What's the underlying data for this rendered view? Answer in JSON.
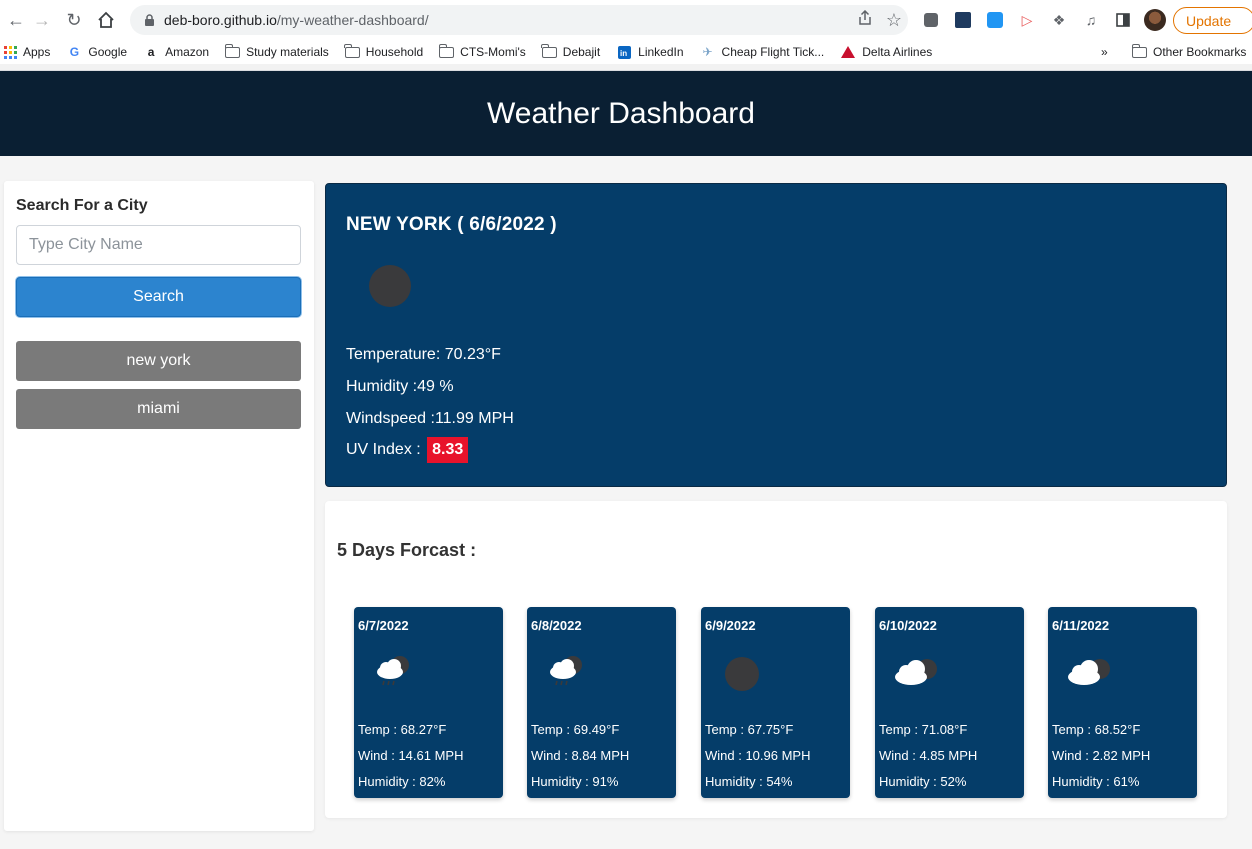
{
  "browser": {
    "url_host": "deb-boro.github.io",
    "url_path": "/my-weather-dashboard/",
    "update_label": "Update",
    "bookmarks": [
      "Apps",
      "Google",
      "Amazon",
      "Study materials",
      "Household",
      "CTS-Momi's",
      "Debajit",
      "LinkedIn",
      "Cheap Flight Tick...",
      "Delta Airlines"
    ],
    "overflow": "»",
    "other_bookmarks": "Other Bookmarks"
  },
  "header": {
    "title": "Weather Dashboard"
  },
  "sidebar": {
    "heading": "Search For a City",
    "input_placeholder": "Type City Name",
    "search_label": "Search",
    "history": [
      "new york",
      "miami"
    ]
  },
  "current": {
    "city_line": "NEW YORK ( 6/6/2022 )",
    "temperature": "Temperature: 70.23°F",
    "humidity": "Humidity :49 %",
    "windspeed": "Windspeed :11.99 MPH",
    "uv_label": "UV Index :",
    "uv_value": "8.33",
    "uv_color": "#e8132b",
    "icon": "dark-circle"
  },
  "forecast": {
    "heading": "5 Days Forcast :",
    "days": [
      {
        "date": "6/7/2022",
        "icon": "rain-cloud",
        "temp": "Temp : 68.27°F",
        "wind": "Wind : 14.61 MPH",
        "humidity": "Humidity : 82%"
      },
      {
        "date": "6/8/2022",
        "icon": "rain-cloud",
        "temp": "Temp : 69.49°F",
        "wind": "Wind : 8.84 MPH",
        "humidity": "Humidity : 91%"
      },
      {
        "date": "6/9/2022",
        "icon": "dark-circle",
        "temp": "Temp : 67.75°F",
        "wind": "Wind : 10.96 MPH",
        "humidity": "Humidity : 54%"
      },
      {
        "date": "6/10/2022",
        "icon": "cloudy",
        "temp": "Temp : 71.08°F",
        "wind": "Wind : 4.85 MPH",
        "humidity": "Humidity : 52%"
      },
      {
        "date": "6/11/2022",
        "icon": "cloudy",
        "temp": "Temp : 68.52°F",
        "wind": "Wind : 2.82 MPH",
        "humidity": "Humidity : 61%"
      }
    ]
  },
  "colors": {
    "header_bg": "#0a1f33",
    "card_bg": "#053d69",
    "search_btn": "#2c84cf",
    "history_btn": "#7a7a7a"
  }
}
